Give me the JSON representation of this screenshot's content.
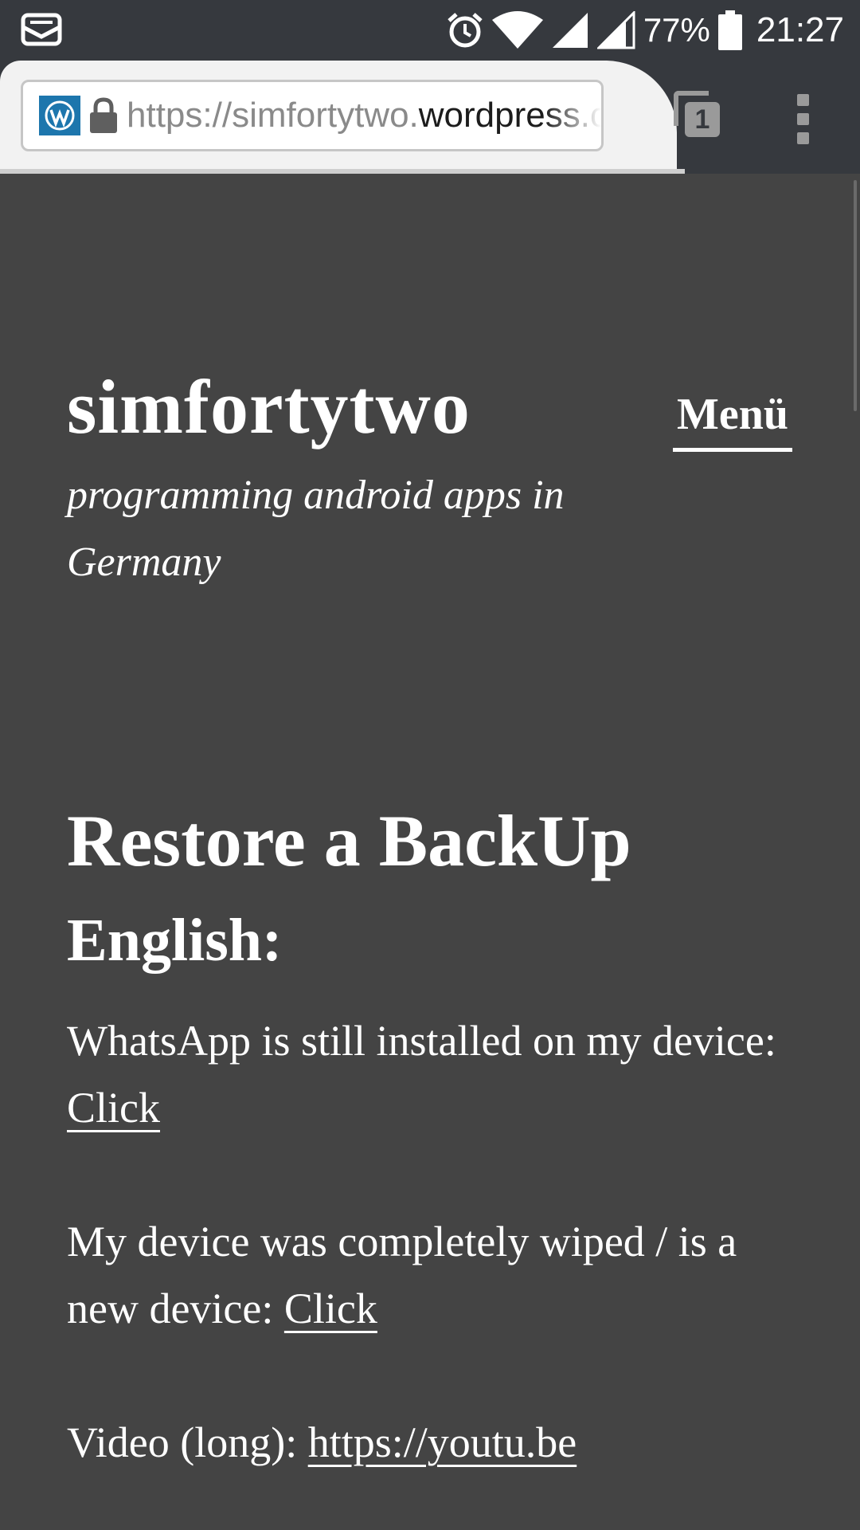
{
  "status_bar": {
    "battery_percent": "77%",
    "time": "21:27",
    "icons": [
      "notification-email-icon",
      "alarm-icon",
      "wifi-icon",
      "signal-icon",
      "battery-icon"
    ]
  },
  "browser": {
    "url_scheme": "https://simfortytwo.",
    "url_domain": "wordpress.com",
    "tab_count": "1",
    "icons": [
      "wordpress-favicon-icon",
      "lock-icon",
      "tabs-icon",
      "overflow-menu-icon"
    ]
  },
  "site": {
    "title": "simfortytwo",
    "tagline": "programming android apps in Germany",
    "menu_label": "Menü"
  },
  "post": {
    "title": "Restore a BackUp",
    "heading": "English:",
    "paragraphs": [
      {
        "text": "WhatsApp is still installed on my device: ",
        "link": "Click"
      },
      {
        "text": "My device was completely wiped / is a new device: ",
        "link": "Click"
      },
      {
        "text": "Video (long): ",
        "link": "https://youtu.be"
      }
    ]
  },
  "colors": {
    "page_background": "#444444",
    "chrome_dark": "#36393e",
    "wordpress_blue": "#1d76ad",
    "text": "#ffffff"
  }
}
